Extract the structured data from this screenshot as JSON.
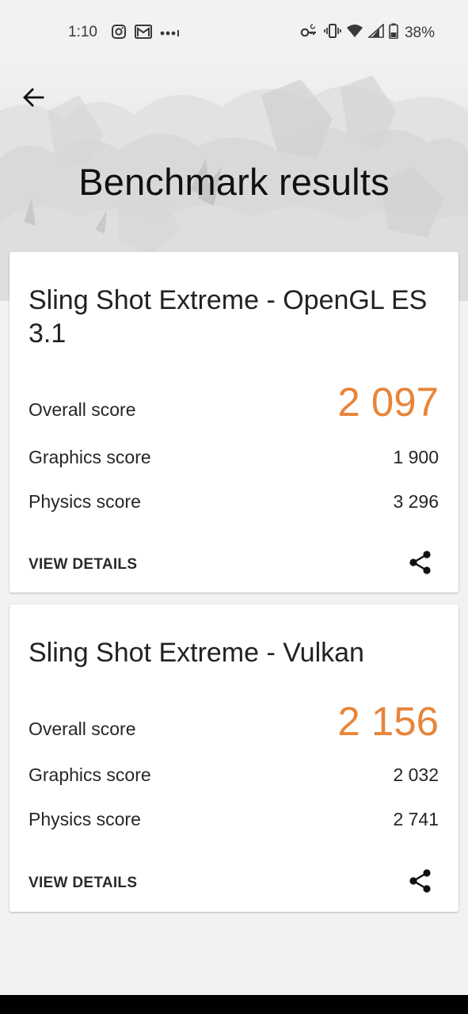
{
  "status_bar": {
    "time": "1:10",
    "battery": "38%",
    "icons_left": [
      "instagram-icon",
      "gmail-icon",
      "more-dots-icon"
    ],
    "icons_right": [
      "vpn-key-icon",
      "vibrate-icon",
      "wifi-icon",
      "signal-icon",
      "battery-icon"
    ]
  },
  "header": {
    "title": "Benchmark results",
    "back_icon": "arrow-back-icon"
  },
  "results": [
    {
      "test_name": "Sling Shot Extreme - OpenGL ES 3.1",
      "overall_label": "Overall score",
      "overall_value": "2 097",
      "graphics_label": "Graphics score",
      "graphics_value": "1 900",
      "physics_label": "Physics score",
      "physics_value": "3 296",
      "action_label": "VIEW DETAILS",
      "share_icon": "share-icon"
    },
    {
      "test_name": "Sling Shot Extreme - Vulkan",
      "overall_label": "Overall score",
      "overall_value": "2 156",
      "graphics_label": "Graphics score",
      "graphics_value": "2 032",
      "physics_label": "Physics score",
      "physics_value": "2 741",
      "action_label": "VIEW DETAILS",
      "share_icon": "share-icon"
    }
  ],
  "colors": {
    "accent": "#e8843a",
    "background": "#f2f2f2",
    "card": "#ffffff"
  }
}
